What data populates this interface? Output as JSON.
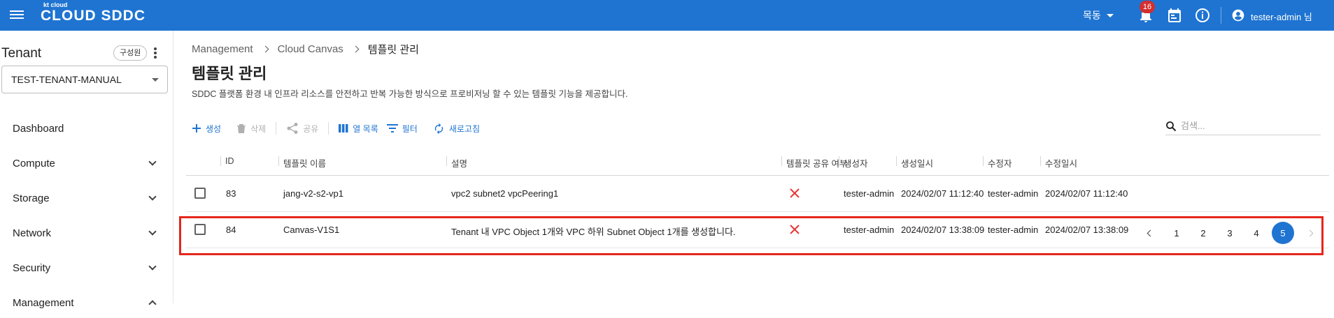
{
  "topbar": {
    "logo_small": "kt cloud",
    "logo_name": "CLOUD SDDC",
    "region": "목동",
    "notification_count": "16",
    "user": "tester-admin 님"
  },
  "sidebar": {
    "tenant_title": "Tenant",
    "members_label": "구성원",
    "tenant_value": "TEST-TENANT-MANUAL",
    "items": [
      {
        "label": "Dashboard"
      },
      {
        "label": "Compute"
      },
      {
        "label": "Storage"
      },
      {
        "label": "Network"
      },
      {
        "label": "Security"
      },
      {
        "label": "Management"
      }
    ]
  },
  "breadcrumb": [
    "Management",
    "Cloud Canvas",
    "템플릿 관리"
  ],
  "page": {
    "title": "템플릿 관리",
    "description": "SDDC 플랫폼 환경 내 인프라 리소스를 안전하고 반복 가능한 방식으로 프로비저닝 할 수 있는 템플릿 기능을 제공합니다."
  },
  "toolbar": {
    "create": "생성",
    "delete": "삭제",
    "share": "공유",
    "columns": "열 목록",
    "filter": "필터",
    "refresh": "새로고침",
    "search_placeholder": "검색..."
  },
  "table": {
    "headers": [
      "ID",
      "템플릿 이름",
      "설명",
      "템플릿 공유 여부",
      "생성자",
      "생성일시",
      "수정자",
      "수정일시"
    ],
    "rows": [
      {
        "id": "83",
        "name": "jang-v2-s2-vp1",
        "desc": "vpc2 subnet2 vpcPeering1",
        "shared": false,
        "creator": "tester-admin",
        "created": "2024/02/07 11:12:40",
        "modifier": "tester-admin",
        "modified": "2024/02/07 11:12:40"
      },
      {
        "id": "84",
        "name": "Canvas-V1S1",
        "desc": "Tenant 내 VPC Object 1개와 VPC 하위 Subnet Object 1개를 생성합니다.",
        "shared": false,
        "creator": "tester-admin",
        "created": "2024/02/07 13:38:09",
        "modifier": "tester-admin",
        "modified": "2024/02/07 13:38:09"
      }
    ]
  },
  "pagination": {
    "pages": [
      "1",
      "2",
      "3",
      "4",
      "5"
    ],
    "current": "5"
  },
  "colors": {
    "primary": "#1f74d1",
    "highlight": "#e5261c",
    "badge": "#d32f2f",
    "x_mark": "#e53935"
  }
}
